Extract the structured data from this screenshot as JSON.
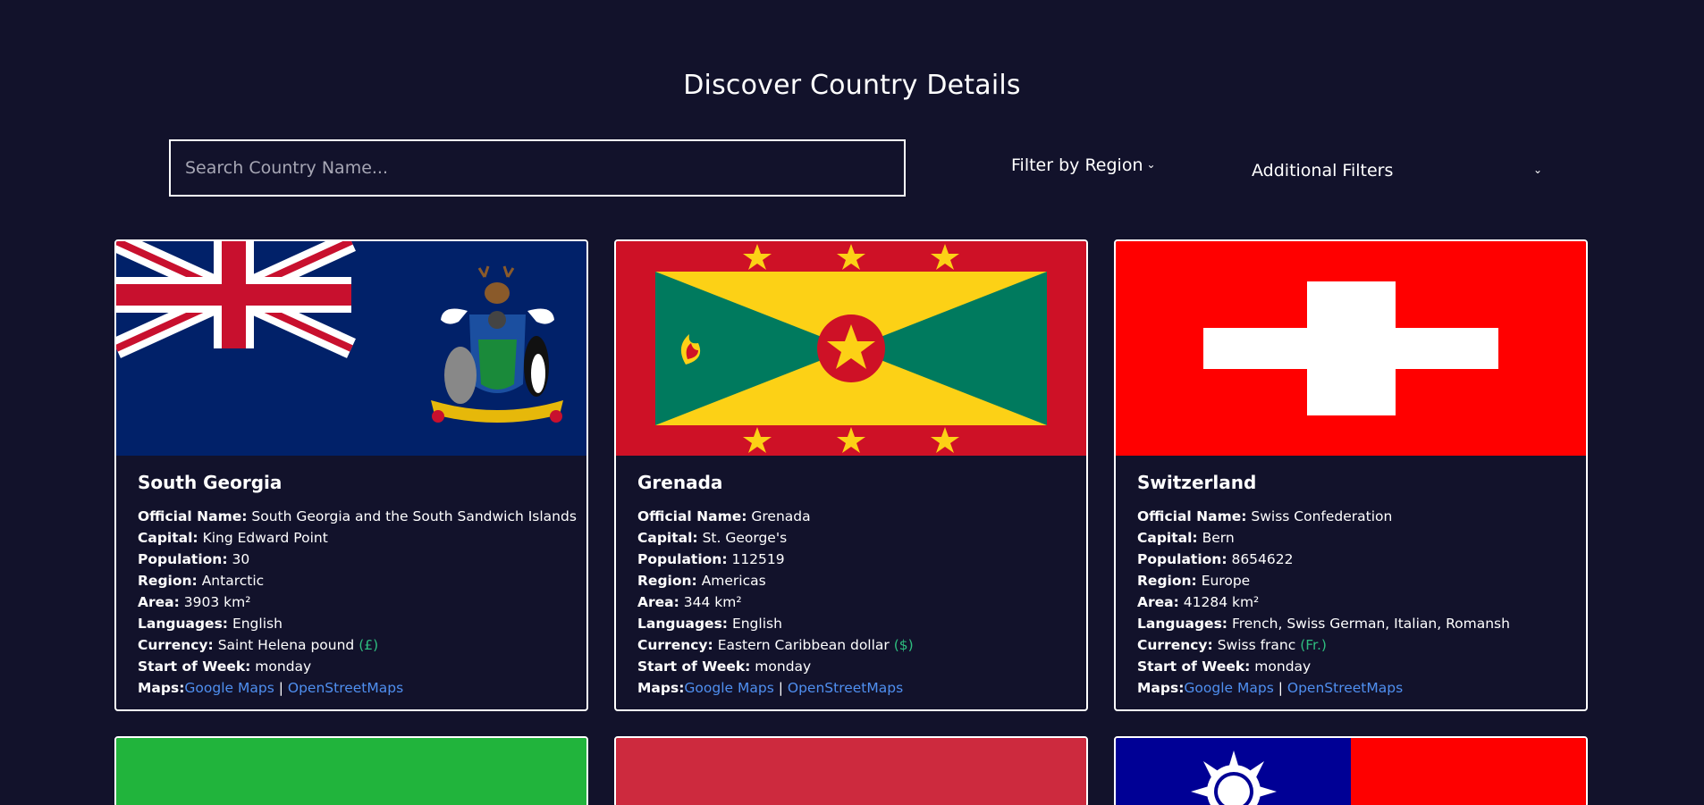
{
  "page_title": "Discover Country Details",
  "search": {
    "placeholder": "Search Country Name..."
  },
  "filters": {
    "region_label": "Filter by Region",
    "additional_label": "Additional Filters"
  },
  "labels": {
    "official_name": "Official Name:",
    "capital": "Capital:",
    "population": "Population:",
    "region": "Region:",
    "area": "Area:",
    "languages": "Languages:",
    "currency": "Currency:",
    "start_of_week": "Start of Week:",
    "maps": "Maps:",
    "google_maps": "Google Maps",
    "separator": "|",
    "osm": "OpenStreetMaps"
  },
  "countries": [
    {
      "name": "South Georgia",
      "official_name": "South Georgia and the South Sandwich Islands",
      "capital": "King Edward Point",
      "population": "30",
      "region": "Antarctic",
      "area": "3903 km²",
      "languages": "English",
      "currency": "Saint Helena pound",
      "currency_symbol": "(£)",
      "start_of_week": "monday",
      "flag_icon": "south-georgia-flag"
    },
    {
      "name": "Grenada",
      "official_name": "Grenada",
      "capital": "St. George's",
      "population": "112519",
      "region": "Americas",
      "area": "344 km²",
      "languages": "English",
      "currency": "Eastern Caribbean dollar",
      "currency_symbol": "($)",
      "start_of_week": "monday",
      "flag_icon": "grenada-flag"
    },
    {
      "name": "Switzerland",
      "official_name": "Swiss Confederation",
      "capital": "Bern",
      "population": "8654622",
      "region": "Europe",
      "area": "41284 km²",
      "languages": "French, Swiss German, Italian, Romansh",
      "currency": "Swiss franc",
      "currency_symbol": "(Fr.)",
      "start_of_week": "monday",
      "flag_icon": "switzerland-flag"
    }
  ],
  "partial_cards": [
    {
      "flag_icon": "green-flag",
      "color": "#21b43c"
    },
    {
      "flag_icon": "red-flag",
      "color": "#cd2a3e"
    },
    {
      "flag_icon": "taiwan-flag",
      "colors": [
        "#000095",
        "#fe0000"
      ]
    }
  ],
  "colors": {
    "background": "#12122b",
    "link": "#4f8ff0",
    "currency_symbol": "#2ebd7f"
  }
}
